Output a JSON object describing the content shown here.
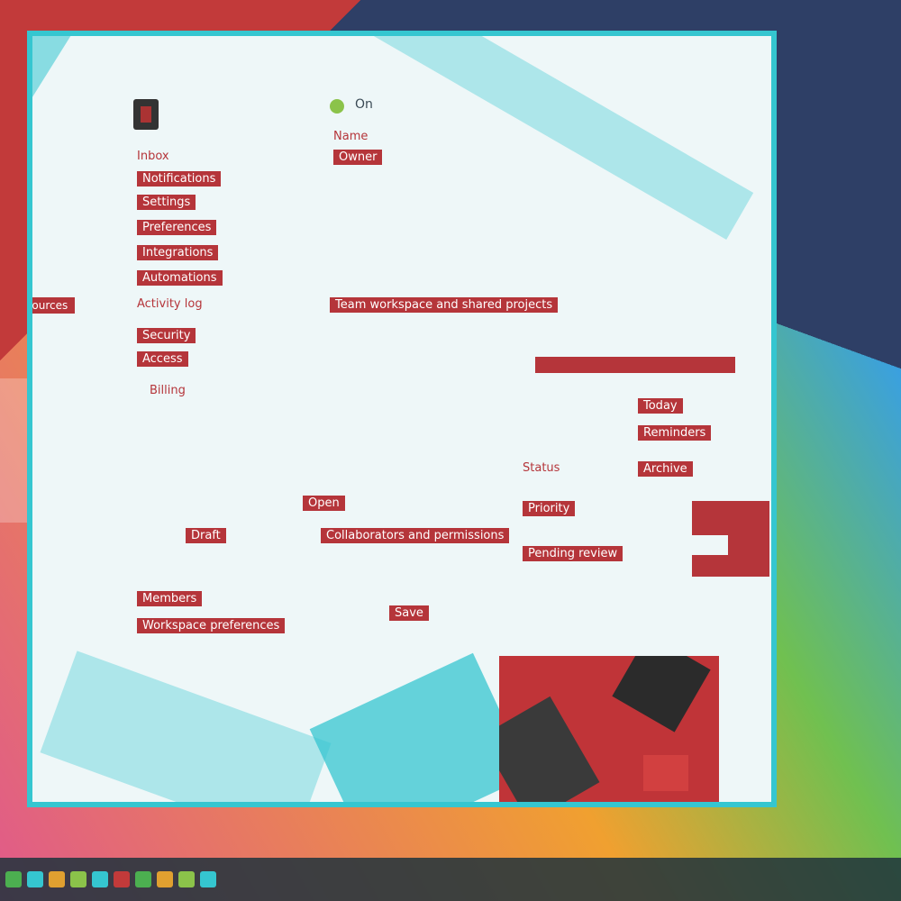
{
  "window": {
    "status_text": "On"
  },
  "left_list": [
    "Inbox",
    "Notifications",
    "Settings",
    "Preferences",
    "Integrations",
    "Automations",
    "Activity log",
    "Security",
    "Access",
    "Billing"
  ],
  "right_col_labels": [
    "Name",
    "Owner"
  ],
  "side_tab_label": "Resources",
  "section_labels": {
    "header_row": "Team workspace and shared projects",
    "banner": "",
    "cols": [
      "Status",
      "Priority"
    ],
    "row_a": "Open",
    "row_b": "Collaborators and permissions",
    "row_c_left": "Draft",
    "row_c_right": "Pending review",
    "footer_left": "Members",
    "footer_wide": "Workspace preferences",
    "footer_right": "Save"
  },
  "right_panel": {
    "item1": "Today",
    "item2": "Reminders",
    "item3": "Archive"
  },
  "taskbar_icons": [
    "start-icon",
    "search-icon",
    "browser-icon",
    "files-icon",
    "mail-icon",
    "terminal-icon",
    "settings-icon",
    "music-icon",
    "photos-icon",
    "chat-icon"
  ]
}
